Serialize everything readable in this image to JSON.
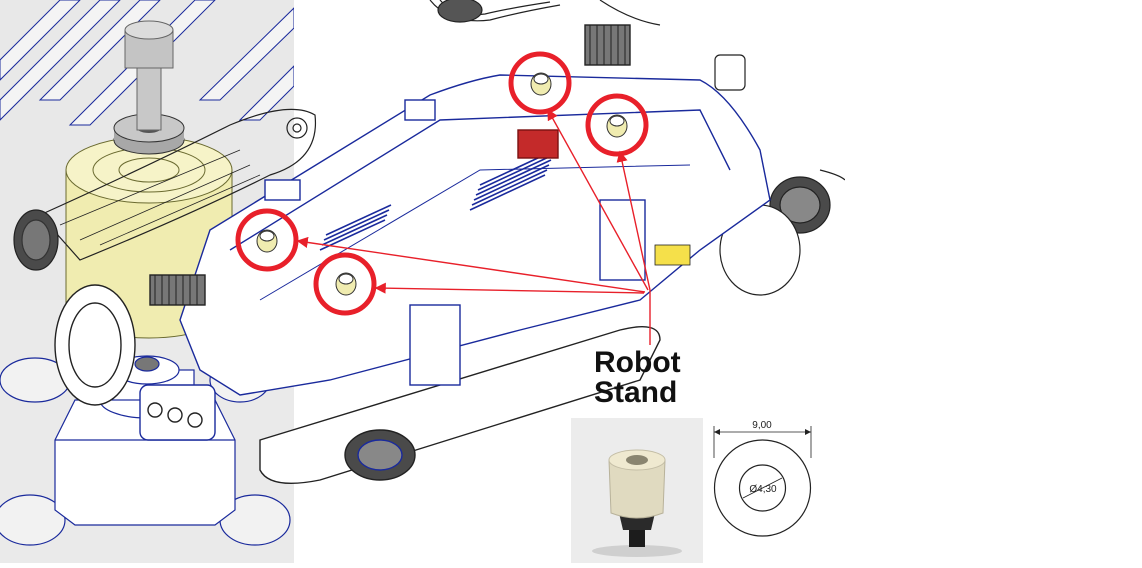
{
  "callout": {
    "line1": "Robot",
    "line2": "Stand"
  },
  "dimensions": {
    "outer_width": "9,00",
    "inner_diameter": "Ø4,30"
  },
  "colors": {
    "outline": "#1a2a9c",
    "highlight": "#e8202a",
    "stand_yellow": "#f0ecb0",
    "side_bg": "#eaeaea"
  },
  "stands": [
    {
      "id": "stand-top-left"
    },
    {
      "id": "stand-top-right"
    },
    {
      "id": "stand-mid-left"
    },
    {
      "id": "stand-mid-center"
    }
  ]
}
